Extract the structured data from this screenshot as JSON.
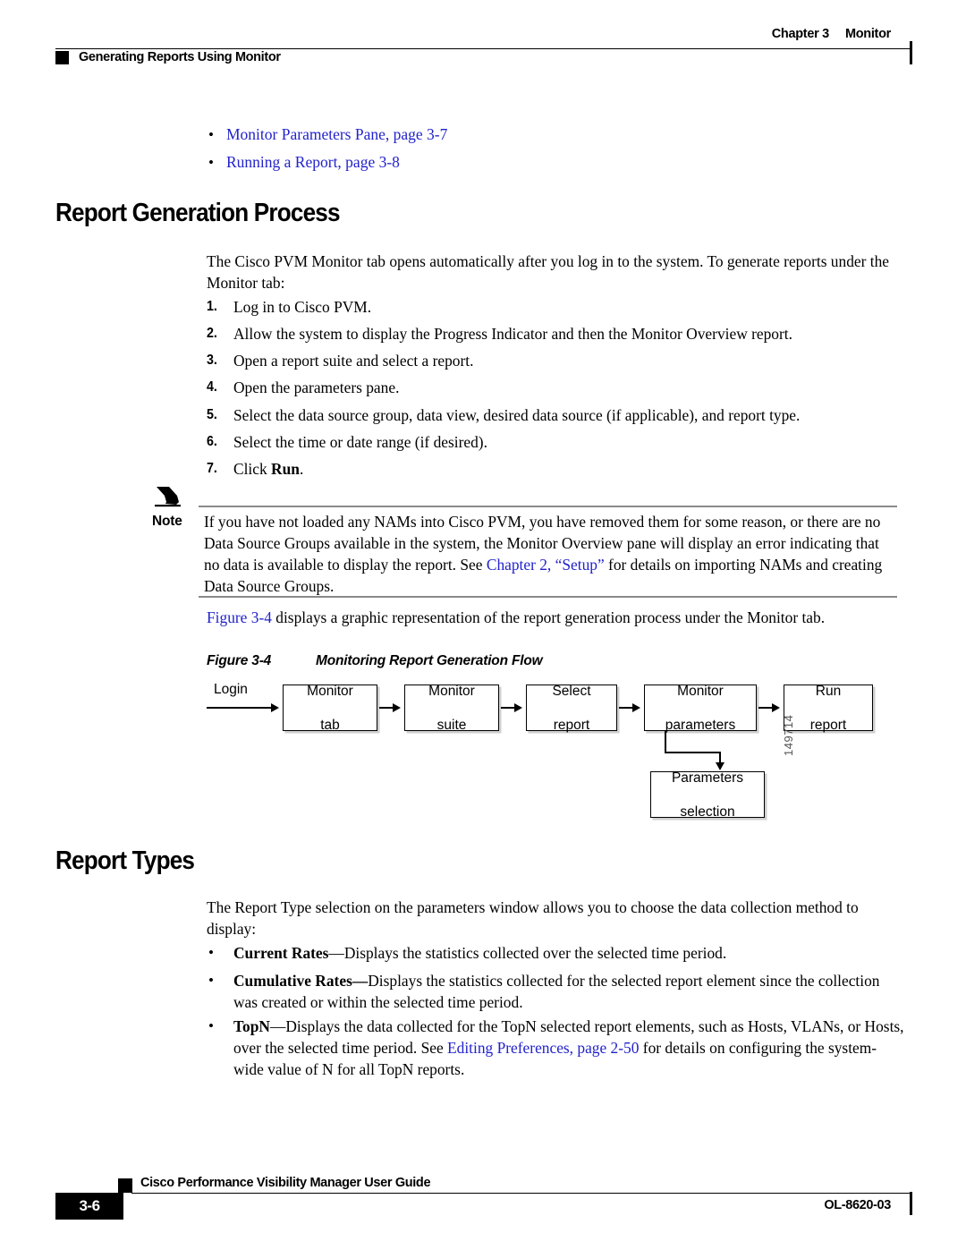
{
  "header": {
    "chapter": "Chapter 3",
    "section": "Monitor",
    "running_head": "Generating Reports Using Monitor"
  },
  "cross_reference_links": [
    {
      "text": "Monitor Parameters Pane, page 3-7"
    },
    {
      "text": "Running a Report, page 3-8"
    }
  ],
  "sections": [
    {
      "title": "Report Generation Process",
      "intro": "The Cisco PVM Monitor tab opens automatically after you log in to the system. To generate reports under the Monitor tab:",
      "steps": [
        {
          "num": "1.",
          "text": "Log in to Cisco PVM."
        },
        {
          "num": "2.",
          "text": "Allow the system to display the Progress Indicator and then the Monitor Overview report."
        },
        {
          "num": "3.",
          "text": "Open a report suite and select a report."
        },
        {
          "num": "4.",
          "text": "Open the parameters pane."
        },
        {
          "num": "5.",
          "text": "Select the data source group, data view, desired data source (if applicable), and report type."
        },
        {
          "num": "6.",
          "text": "Select the time or date range (if desired)."
        },
        {
          "num": "7.",
          "text": "Click ",
          "bold_tail": "Run",
          "tail": "."
        }
      ]
    },
    {
      "title": "Report Types",
      "intro": "The Report Type selection on the parameters window allows you to choose the data collection method to display:"
    }
  ],
  "note": {
    "label": "Note",
    "part1": "If you have not loaded any NAMs into Cisco PVM, you have removed them for some reason, or there are no Data Source Groups available in the system, the Monitor Overview pane will display an error indicating that no data is available to display the report. See ",
    "link": "Chapter 2, “Setup”",
    "part2": " for details on importing NAMs and creating Data Source Groups."
  },
  "figure_intro": {
    "link": "Figure 3-4",
    "rest": " displays a graphic representation of the report generation process under the Monitor tab."
  },
  "figure": {
    "number": "Figure 3-4",
    "title": "Monitoring Report Generation Flow",
    "id": "149714",
    "entry_label": "Login",
    "boxes": [
      {
        "line1": "Monitor",
        "line2": "tab"
      },
      {
        "line1": "Monitor",
        "line2": "suite"
      },
      {
        "line1": "Select",
        "line2": "report"
      },
      {
        "line1": "Monitor",
        "line2": "parameters"
      },
      {
        "line1": "Run",
        "line2": "report"
      },
      {
        "line1": "Parameters",
        "line2": "selection"
      }
    ]
  },
  "report_type_bullets": [
    {
      "term": "Current Rates",
      "dash": "—",
      "text": "Displays the statistics collected over the selected time period."
    },
    {
      "term": "Cumulative Rates",
      "dash": "—",
      "text": "Displays the statistics collected for the selected report element since the collection was created or within the selected time period."
    },
    {
      "term": "TopN",
      "dash": "—",
      "text": "Displays the data collected for the TopN selected report elements, such as Hosts, VLANs, or Hosts, over the selected time period. See ",
      "link": "Editing Preferences, page 2-50",
      "text_tail": " for details on configuring the system-wide value of N for all TopN reports."
    }
  ],
  "footer": {
    "page_number": "3-6",
    "guide_title": "Cisco Performance Visibility Manager User Guide",
    "doc_id": "OL-8620-03"
  },
  "colors": {
    "link": "#2222cc",
    "rule": "#000000",
    "note_rule": "#8a8a8a"
  }
}
